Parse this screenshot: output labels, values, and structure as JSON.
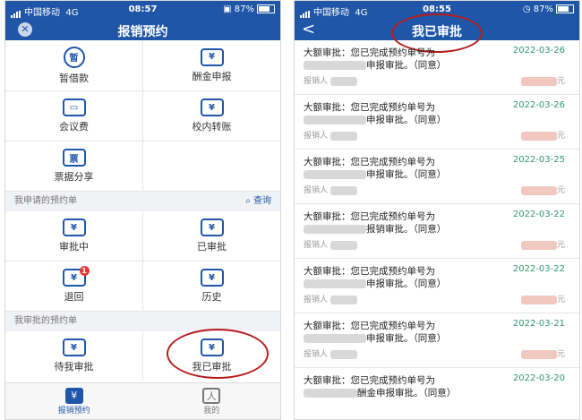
{
  "left": {
    "status": {
      "carrier": "中国移动",
      "network": "4G",
      "time": "08:57",
      "battery": "87%"
    },
    "nav": {
      "title": "报销预约"
    },
    "grid_top": [
      [
        {
          "label": "暂借款",
          "icon": "暂"
        },
        {
          "label": "酬金申报",
          "icon": "¥"
        }
      ],
      [
        {
          "label": "会议费",
          "icon": "▭"
        },
        {
          "label": "校内转账",
          "icon": "¥"
        }
      ],
      [
        {
          "label": "票据分享",
          "icon": "票"
        },
        {
          "label": "",
          "icon": ""
        }
      ]
    ],
    "section_mine": {
      "title": "我申请的预约单",
      "query": "查询"
    },
    "grid_mine": [
      [
        {
          "label": "审批中",
          "icon": "¥"
        },
        {
          "label": "已审批",
          "icon": "¥"
        }
      ],
      [
        {
          "label": "退回",
          "icon": "¥",
          "badge": "1"
        },
        {
          "label": "历史",
          "icon": "¥"
        }
      ]
    ],
    "section_approve": {
      "title": "我审批的预约单"
    },
    "grid_approve": [
      [
        {
          "label": "待我审批",
          "icon": "¥"
        },
        {
          "label": "我已审批",
          "icon": "¥"
        }
      ]
    ],
    "tabbar": [
      {
        "label": "报销预约",
        "icon": "¥"
      },
      {
        "label": "我的",
        "icon": "人"
      }
    ]
  },
  "right": {
    "status": {
      "carrier": "中国移动",
      "network": "4G",
      "time": "08:55",
      "battery": "87%"
    },
    "nav": {
      "title": "我已审批",
      "back": "<"
    },
    "items": [
      {
        "line1": "大额审批：您已完成预约单号为",
        "line2": "申报审批。（同意）",
        "reporter": "报销人",
        "date": "2022-03-26",
        "unit": "元"
      },
      {
        "line1": "大额审批：您已完成预约单号为",
        "line2": "申报审批。（同意）",
        "reporter": "报销人",
        "date": "2022-03-26",
        "unit": "元"
      },
      {
        "line1": "大额审批：您已完成预约单号为",
        "line2": "申报审批。（同意）",
        "reporter": "报销人",
        "date": "2022-03-25",
        "unit": "元"
      },
      {
        "line1": "大额审批：您已完成预约单号为",
        "line2": "报销审批。（同意）",
        "reporter": "报销人",
        "date": "2022-03-22",
        "unit": "元"
      },
      {
        "line1": "大额审批：您已完成预约单号为",
        "line2": "申报审批。（同意）",
        "reporter": "报销人",
        "date": "2022-03-22",
        "unit": "元"
      },
      {
        "line1": "大额审批：您已完成预约单号为",
        "line2": "申报审批。（同意）",
        "reporter": "报销人",
        "date": "2022-03-21",
        "unit": "元"
      },
      {
        "line1": "大额审批：您已完成预约单号为",
        "line2": "酬金申报审批。（同意）",
        "reporter": "报销人",
        "date": "2022-03-20",
        "unit": "元"
      }
    ]
  },
  "colors": {
    "primary": "#1f56a8",
    "highlight": "#b71c1c",
    "date": "#2e9a6e",
    "badge": "#e53935"
  }
}
